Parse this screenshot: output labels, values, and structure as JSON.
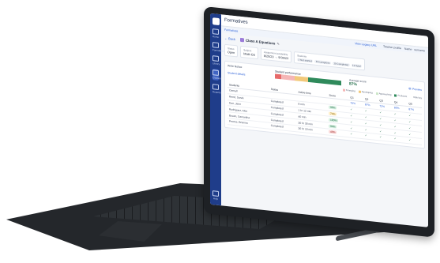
{
  "app": {
    "title": "Formatives"
  },
  "subbar": {
    "left_link": "Formatives",
    "view_link": "View Legacy URL",
    "profile": "Teacher profile",
    "user": "Name · surname"
  },
  "sidebar": {
    "items": [
      {
        "label": "Home",
        "icon": "home-icon"
      },
      {
        "label": "Formatives",
        "icon": "formatives-icon"
      },
      {
        "label": "Library",
        "icon": "library-icon"
      },
      {
        "label": "Classes",
        "icon": "classes-icon"
      },
      {
        "label": "Reports",
        "icon": "reports-icon"
      }
    ],
    "bottom": "Help"
  },
  "header": {
    "back": "Back",
    "class_name": "Class A Equations"
  },
  "cards": {
    "status_label": "Status",
    "status_value": "Open",
    "subject_label": "Subject",
    "subject_value": "Math G5",
    "availability_label": "Assignment availability",
    "availability_value": "8/20/23 → 9/30/23",
    "students_label": "Students",
    "students_chips": [
      "Not started",
      "In progress",
      "Completed",
      "Total"
    ],
    "students_values": [
      "2",
      "8",
      "10",
      "10"
    ]
  },
  "performance": {
    "write_notice": "Write Notice",
    "student_details": "Student details",
    "title": "Student performance",
    "avg_label": "Average score",
    "avg_value": "87%",
    "preview": "Preview",
    "segments": [
      {
        "color": "#e66a6a",
        "fraction": 0.1
      },
      {
        "color": "#f5b6b6",
        "fraction": 0.2
      },
      {
        "color": "#f2c97a",
        "fraction": 0.2
      },
      {
        "color": "#2f8a5b",
        "fraction": 0.5
      }
    ]
  },
  "legend": [
    {
      "label": "Emerging",
      "color": "#f5b6b6"
    },
    {
      "label": "Developing",
      "color": "#f2c97a"
    },
    {
      "label": "Approaching",
      "color": "#cde7c9"
    },
    {
      "label": "Proficient",
      "color": "#2f8a5b"
    },
    {
      "label": "Hide key",
      "color": "#ffffff"
    }
  ],
  "table": {
    "headers": [
      "Students",
      "Status",
      "Active time",
      "Score",
      "Q1",
      "Q2",
      "Q3",
      "Q4",
      "Q5"
    ],
    "overall": [
      "Overall",
      "",
      "",
      "",
      "75%",
      "87%",
      "72%",
      "80%",
      "87%"
    ],
    "rows": [
      [
        "Reed, Sarah",
        "Completed",
        "8 min",
        "90%",
        "✓",
        "✓",
        "✓",
        "✓",
        "✓"
      ],
      [
        "Doe, Jane",
        "Completed",
        "1 hr 12 min",
        "74%",
        "✓",
        "✓",
        "✓",
        "✓",
        "✓"
      ],
      [
        "Rodriguez, Alex",
        "Completed",
        "40 min",
        "100%",
        "✓",
        "✓",
        "✓",
        "✓",
        "✓"
      ],
      [
        "Brown, Samantha",
        "Completed",
        "30 hr 30 min",
        "94%",
        "✓",
        "✓",
        "✓",
        "✓",
        "✓"
      ],
      [
        "Pearce, Brianna",
        "Completed",
        "30 hr 10 min",
        "43%",
        "✓",
        "✓",
        "✓",
        "✓",
        "✓"
      ]
    ]
  }
}
